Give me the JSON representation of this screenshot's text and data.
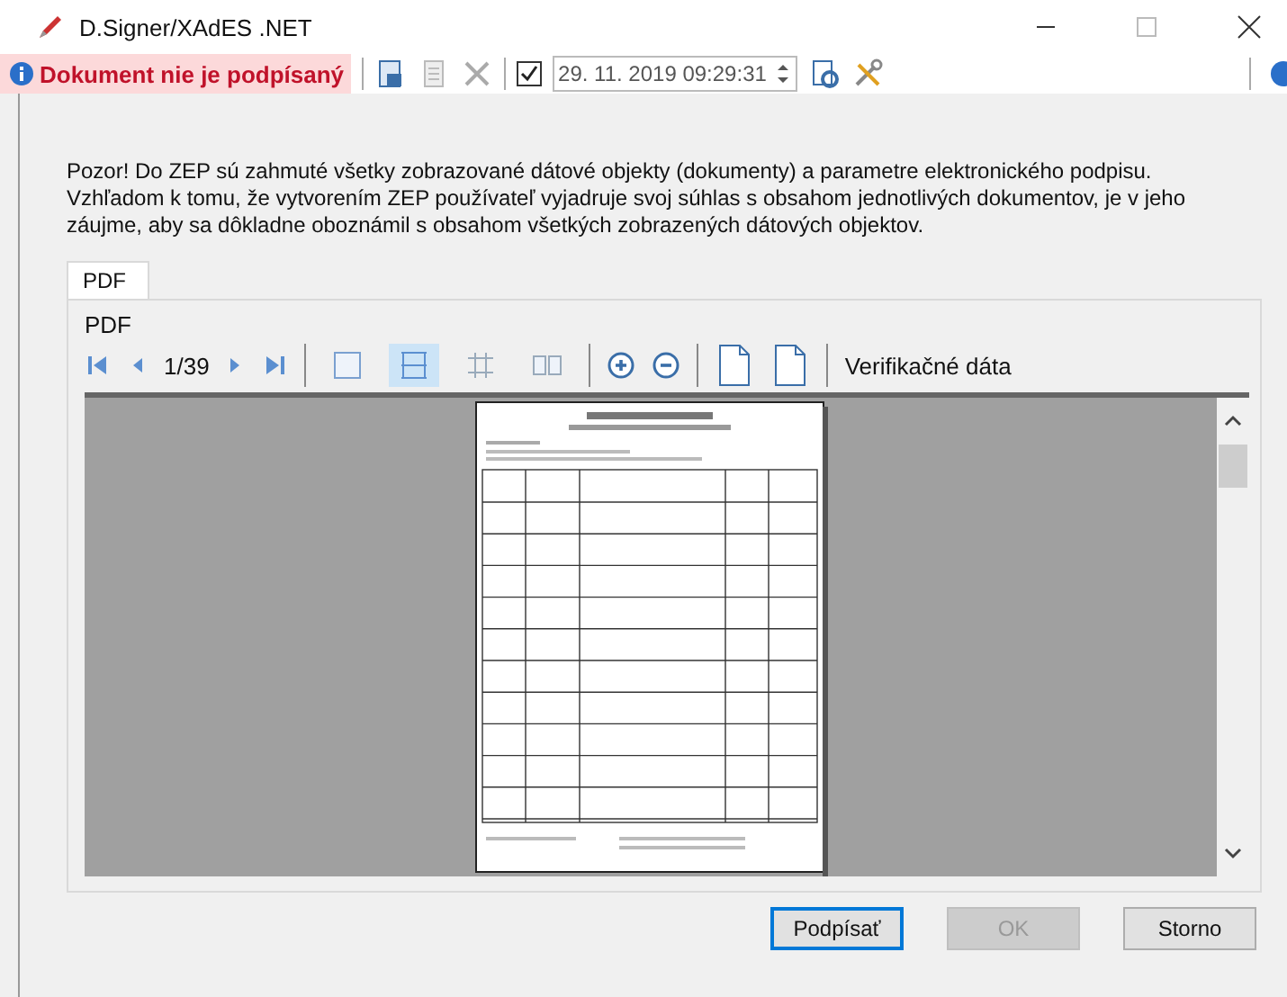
{
  "window": {
    "title": "D.Signer/XAdES .NET"
  },
  "toolbar": {
    "status": "Dokument nie je podpísaný",
    "timestamp_enabled": true,
    "timestamp": "29. 11. 2019 09:29:31"
  },
  "notice": "Pozor! Do ZEP sú zahmuté všetky zobrazované dátové objekty (dokumenty) a parametre elektronického podpisu. Vzhľadom k tomu, že vytvorením ZEP používateľ vyjadruje svoj súhlas s obsahom jednotlivých dokumentov, je v jeho záujme, aby sa dôkladne oboznámil s obsahom všetkých zobrazených dátových objektov.",
  "tabs": [
    {
      "label": "PDF",
      "selected": true
    }
  ],
  "viewer": {
    "title": "PDF",
    "page": "1/39",
    "view_modes": [
      {
        "selected": false
      },
      {
        "selected": true
      },
      {
        "selected": false
      },
      {
        "selected": false
      }
    ],
    "verification_label": "Verifikačné dáta"
  },
  "buttons": [
    {
      "label": "Podpísať",
      "disabled": false,
      "default": true
    },
    {
      "label": "OK",
      "disabled": true,
      "default": false
    },
    {
      "label": "Storno",
      "disabled": false,
      "default": false
    }
  ]
}
